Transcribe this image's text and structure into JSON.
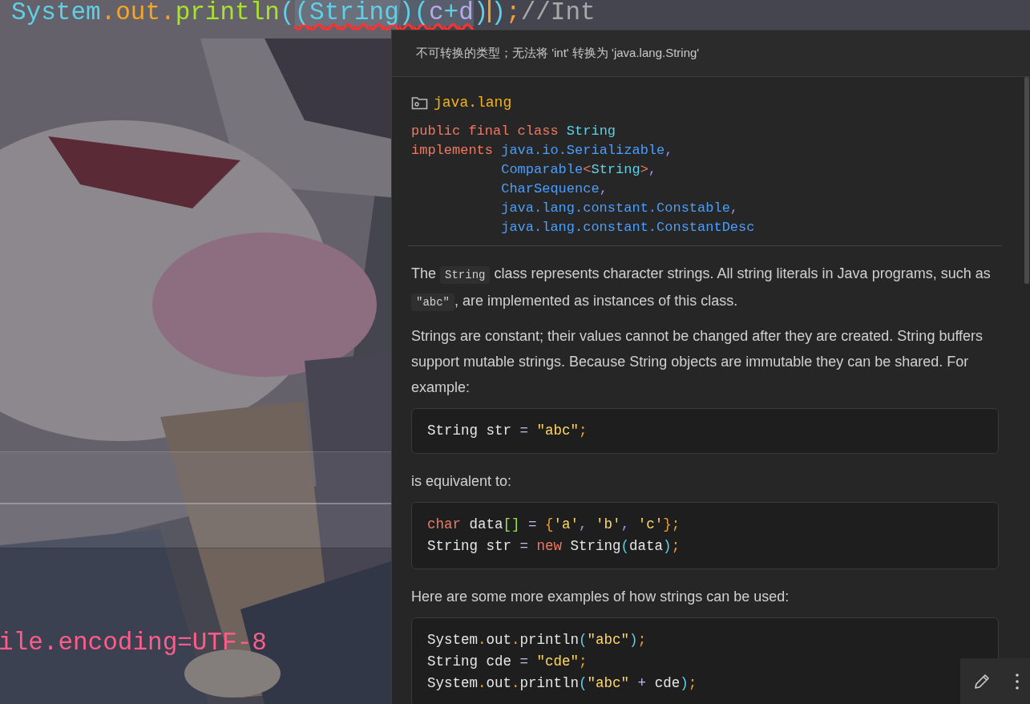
{
  "editor": {
    "code_line": [
      {
        "text": "System",
        "kind": "type",
        "squiggle": false
      },
      {
        "text": ".",
        "kind": "punct",
        "squiggle": false
      },
      {
        "text": "out",
        "kind": "field",
        "squiggle": false
      },
      {
        "text": ".",
        "kind": "punct",
        "squiggle": false
      },
      {
        "text": "println",
        "kind": "method",
        "squiggle": false
      },
      {
        "text": "(",
        "kind": "paren",
        "squiggle": false
      },
      {
        "text": "(String)(c+d",
        "kind": "cast",
        "squiggle": true
      },
      {
        "text": ")",
        "kind": "paren",
        "squiggle": false
      },
      {
        "text": ")",
        "kind": "paren",
        "squiggle": false
      },
      {
        "text": ";",
        "kind": "punct",
        "squiggle": false
      },
      {
        "text": "//Int",
        "kind": "comment",
        "squiggle": false
      }
    ],
    "console_line": "ile.encoding=UTF-8"
  },
  "popup": {
    "error_message": "不可转换的类型；无法将 'int' 转换为 'java.lang.String'",
    "package": "java.lang",
    "signature": [
      [
        {
          "text": "public final class ",
          "kind": "kw"
        },
        {
          "text": "String",
          "kind": "type"
        }
      ],
      [
        {
          "text": "implements ",
          "kind": "kw"
        },
        {
          "text": "java.io.Serializable",
          "kind": "ref"
        },
        {
          "text": ",",
          "kind": "comma"
        }
      ],
      [
        {
          "text": "Comparable",
          "kind": "ref"
        },
        {
          "text": "<",
          "kind": "kw"
        },
        {
          "text": "String",
          "kind": "type"
        },
        {
          "text": ">",
          "kind": "kw"
        },
        {
          "text": ",",
          "kind": "comma"
        }
      ],
      [
        {
          "text": "CharSequence",
          "kind": "ref"
        },
        {
          "text": ",",
          "kind": "comma"
        }
      ],
      [
        {
          "text": "java.lang.constant.Constable",
          "kind": "ref"
        },
        {
          "text": ",",
          "kind": "comma"
        }
      ],
      [
        {
          "text": "java.lang.constant.ConstantDesc",
          "kind": "ref"
        }
      ]
    ],
    "blocks": [
      {
        "kind": "paragraph",
        "segments": [
          {
            "kind": "text",
            "text": "The "
          },
          {
            "kind": "code",
            "text": "String"
          },
          {
            "kind": "text",
            "text": " class represents character strings. All string literals in Java programs, such as "
          },
          {
            "kind": "code",
            "text": "\"abc\""
          },
          {
            "kind": "text",
            "text": ", are implemented as instances of this class."
          }
        ]
      },
      {
        "kind": "paragraph",
        "segments": [
          {
            "kind": "text",
            "text": "Strings are constant; their values cannot be changed after they are created. String buffers support mutable strings. Because String objects are immutable they can be shared. For example:"
          }
        ]
      },
      {
        "kind": "code",
        "lines": [
          [
            {
              "text": "String str ",
              "kind": "plain"
            },
            {
              "text": "= ",
              "kind": "op"
            },
            {
              "text": "\"abc\"",
              "kind": "str"
            },
            {
              "text": ";",
              "kind": "punct"
            }
          ]
        ]
      },
      {
        "kind": "paragraph",
        "segments": [
          {
            "kind": "text",
            "text": "is equivalent to:"
          }
        ]
      },
      {
        "kind": "code",
        "lines": [
          [
            {
              "text": "char",
              "kind": "kw"
            },
            {
              "text": " data",
              "kind": "plain"
            },
            {
              "text": "[]",
              "kind": "bracket"
            },
            {
              "text": " = ",
              "kind": "op"
            },
            {
              "text": "{",
              "kind": "punct"
            },
            {
              "text": "'a'",
              "kind": "str"
            },
            {
              "text": ", ",
              "kind": "comma"
            },
            {
              "text": "'b'",
              "kind": "str"
            },
            {
              "text": ", ",
              "kind": "comma"
            },
            {
              "text": "'c'",
              "kind": "str"
            },
            {
              "text": "}",
              "kind": "punct"
            },
            {
              "text": ";",
              "kind": "punct"
            }
          ],
          [
            {
              "text": "String str ",
              "kind": "plain"
            },
            {
              "text": "= ",
              "kind": "op"
            },
            {
              "text": "new",
              "kind": "kw"
            },
            {
              "text": " String",
              "kind": "plain"
            },
            {
              "text": "(",
              "kind": "paren"
            },
            {
              "text": "data",
              "kind": "plain"
            },
            {
              "text": ")",
              "kind": "paren"
            },
            {
              "text": ";",
              "kind": "punct"
            }
          ]
        ]
      },
      {
        "kind": "paragraph",
        "segments": [
          {
            "kind": "text",
            "text": "Here are some more examples of how strings can be used:"
          }
        ]
      },
      {
        "kind": "code",
        "lines": [
          [
            {
              "text": "System",
              "kind": "plain"
            },
            {
              "text": ".",
              "kind": "punct"
            },
            {
              "text": "out",
              "kind": "plain"
            },
            {
              "text": ".",
              "kind": "punct"
            },
            {
              "text": "println",
              "kind": "plain"
            },
            {
              "text": "(",
              "kind": "paren"
            },
            {
              "text": "\"abc\"",
              "kind": "str"
            },
            {
              "text": ")",
              "kind": "paren"
            },
            {
              "text": ";",
              "kind": "punct"
            }
          ],
          [
            {
              "text": "String cde ",
              "kind": "plain"
            },
            {
              "text": "= ",
              "kind": "op"
            },
            {
              "text": "\"cde\"",
              "kind": "str"
            },
            {
              "text": ";",
              "kind": "punct"
            }
          ],
          [
            {
              "text": "System",
              "kind": "plain"
            },
            {
              "text": ".",
              "kind": "punct"
            },
            {
              "text": "out",
              "kind": "plain"
            },
            {
              "text": ".",
              "kind": "punct"
            },
            {
              "text": "println",
              "kind": "plain"
            },
            {
              "text": "(",
              "kind": "paren"
            },
            {
              "text": "\"abc\"",
              "kind": "str"
            },
            {
              "text": " + ",
              "kind": "op"
            },
            {
              "text": "cde",
              "kind": "plain"
            },
            {
              "text": ")",
              "kind": "paren"
            },
            {
              "text": ";",
              "kind": "punct"
            }
          ]
        ]
      }
    ]
  }
}
